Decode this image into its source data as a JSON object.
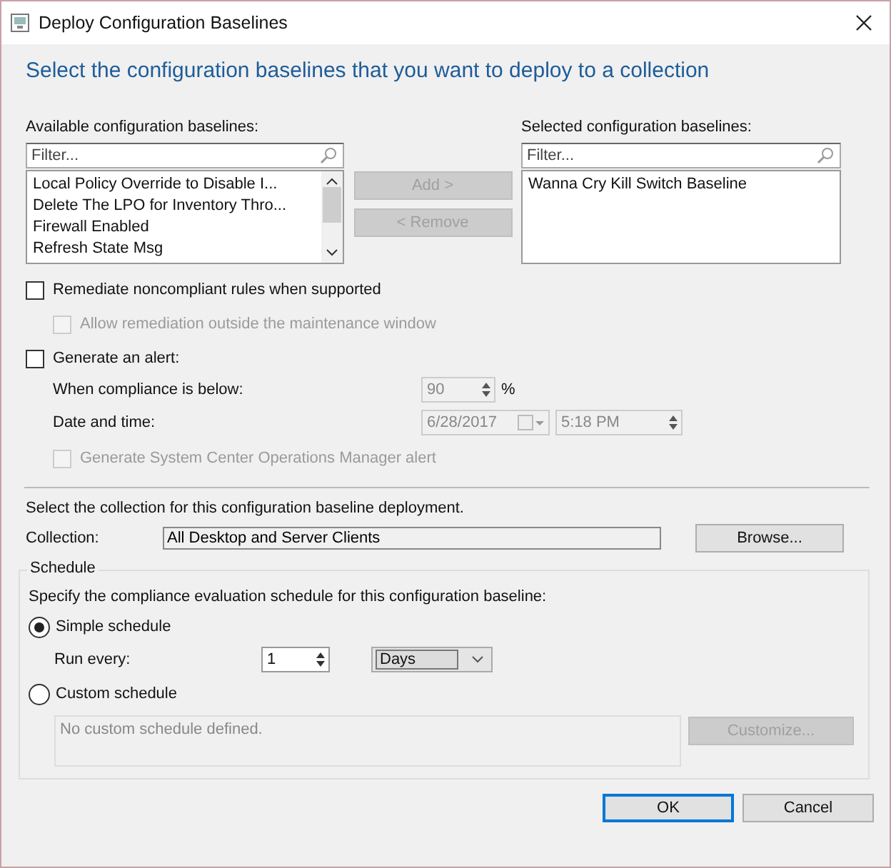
{
  "window": {
    "title": "Deploy Configuration Baselines"
  },
  "heading": "Select the configuration baselines that you want to deploy to a collection",
  "available": {
    "label": "Available configuration baselines:",
    "filter_placeholder": "Filter...",
    "items": [
      {
        "label": "Local Policy Override to Disable I...",
        "selected": false
      },
      {
        "label": "Delete The LPO for Inventory Thro...",
        "selected": false
      },
      {
        "label": "Firewall Enabled",
        "selected": false
      },
      {
        "label": "Refresh State Msg",
        "selected": false
      }
    ]
  },
  "transfer_buttons": [
    {
      "label": "Add >",
      "disabled": true
    },
    {
      "label": "< Remove",
      "disabled": true
    }
  ],
  "selected_baselines": {
    "label": "Selected configuration baselines:",
    "filter_placeholder": "Filter...",
    "items": [
      {
        "label": "Wanna Cry Kill Switch Baseline",
        "selected": false
      }
    ]
  },
  "remediate": {
    "label": "Remediate noncompliant rules when supported",
    "checked": false,
    "disabled": false,
    "children": [
      {
        "label": "Allow remediation outside the maintenance window",
        "checked": false,
        "disabled": true
      }
    ]
  },
  "alert": {
    "label": "Generate an alert:",
    "checked": false,
    "disabled": false,
    "compliance": {
      "label": "When compliance is below:",
      "value": "90",
      "unit": "%",
      "disabled": true
    },
    "date_time": {
      "label": "Date and time:",
      "date": "6/28/2017",
      "time": "5:18 PM",
      "disabled": true
    },
    "scom": {
      "label": "Generate System Center Operations Manager alert",
      "checked": false,
      "disabled": true
    }
  },
  "collection": {
    "prompt": "Select the collection for this configuration baseline deployment.",
    "label": "Collection:",
    "value": "All Desktop and Server Clients",
    "browse_button": "Browse..."
  },
  "schedule": {
    "legend": "Schedule",
    "prompt": "Specify the compliance evaluation schedule for this configuration baseline:",
    "options": [
      {
        "label": "Simple schedule",
        "selected": true
      },
      {
        "label": "Custom schedule",
        "selected": false
      }
    ],
    "run_every": {
      "label": "Run every:",
      "value": "1",
      "unit": "Days"
    },
    "custom_text": "No custom schedule defined.",
    "customize_button": {
      "label": "Customize...",
      "disabled": true
    }
  },
  "buttons": [
    {
      "label": "OK",
      "default": true
    },
    {
      "label": "Cancel",
      "default": false
    }
  ]
}
